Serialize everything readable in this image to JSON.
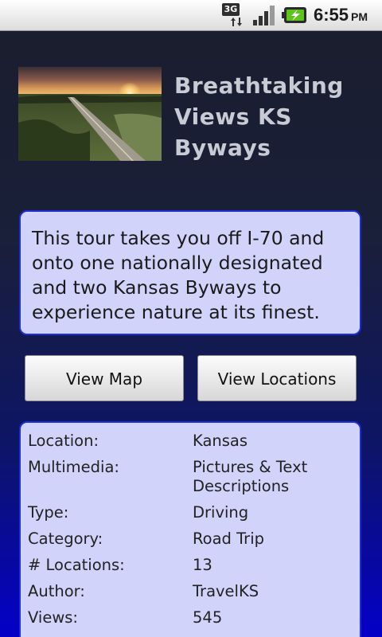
{
  "status_bar": {
    "network": "3G",
    "time": "6:55",
    "ampm": "PM"
  },
  "tour": {
    "title": "Breathtaking Views KS Byways",
    "image": "sunset-road-photo",
    "description": "This tour takes you off I-70 and onto one nationally designated and two Kansas Byways to experience nature at its finest."
  },
  "buttons": {
    "view_map": "View Map",
    "view_locations": "View Locations"
  },
  "details": [
    {
      "label": "Location:",
      "value": "Kansas"
    },
    {
      "label": "Multimedia:",
      "value": "Pictures & Text Descriptions"
    },
    {
      "label": "Type:",
      "value": "Driving"
    },
    {
      "label": "Category:",
      "value": "Road Trip"
    },
    {
      "label": "# Locations:",
      "value": "13"
    },
    {
      "label": "Author:",
      "value": "TravelKS"
    },
    {
      "label": "Views:",
      "value": "545"
    }
  ],
  "colors": {
    "panel_bg": "#d2d3fa",
    "panel_border": "#1c2fd4",
    "title_text": "#c9cbd4"
  }
}
